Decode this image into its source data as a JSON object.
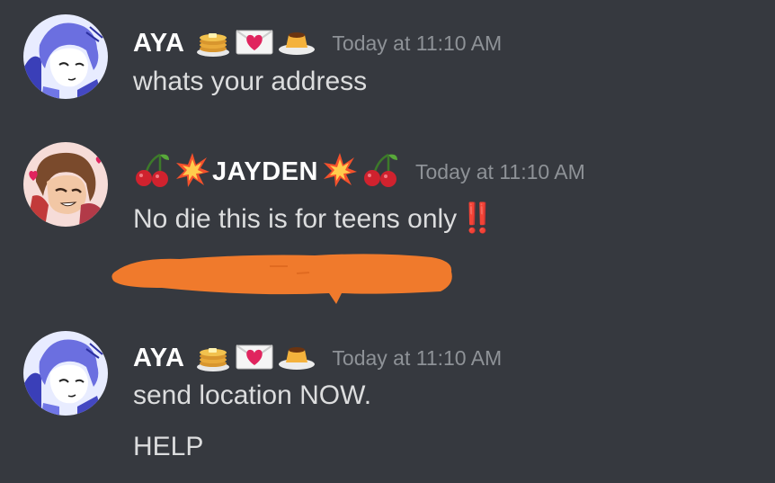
{
  "messages": [
    {
      "username": "AYA",
      "name_emojis": [
        "pancakes-emoji",
        "love-letter-emoji",
        "custard-emoji"
      ],
      "timestamp": "Today at 11:10 AM",
      "lines": [
        "whats your address"
      ]
    },
    {
      "username": "JAYDEN",
      "name_emojis": [
        "cherries-emoji",
        "collision-emoji",
        "collision-emoji",
        "cherries-emoji"
      ],
      "timestamp": "Today at 11:10 AM",
      "lines": [
        "No die this is for teens only"
      ],
      "trailing_emoji": "‼️",
      "redacted_line": true
    },
    {
      "username": "AYA",
      "name_emojis": [
        "pancakes-emoji",
        "love-letter-emoji",
        "custard-emoji"
      ],
      "timestamp": "Today at 11:10 AM",
      "lines": [
        "send location NOW.",
        "HELP"
      ]
    }
  ],
  "colors": {
    "background": "#36393f",
    "username": "#ffffff",
    "message_text": "#dcddde",
    "timestamp": "#8e9297",
    "redaction": "#f07a2c"
  }
}
